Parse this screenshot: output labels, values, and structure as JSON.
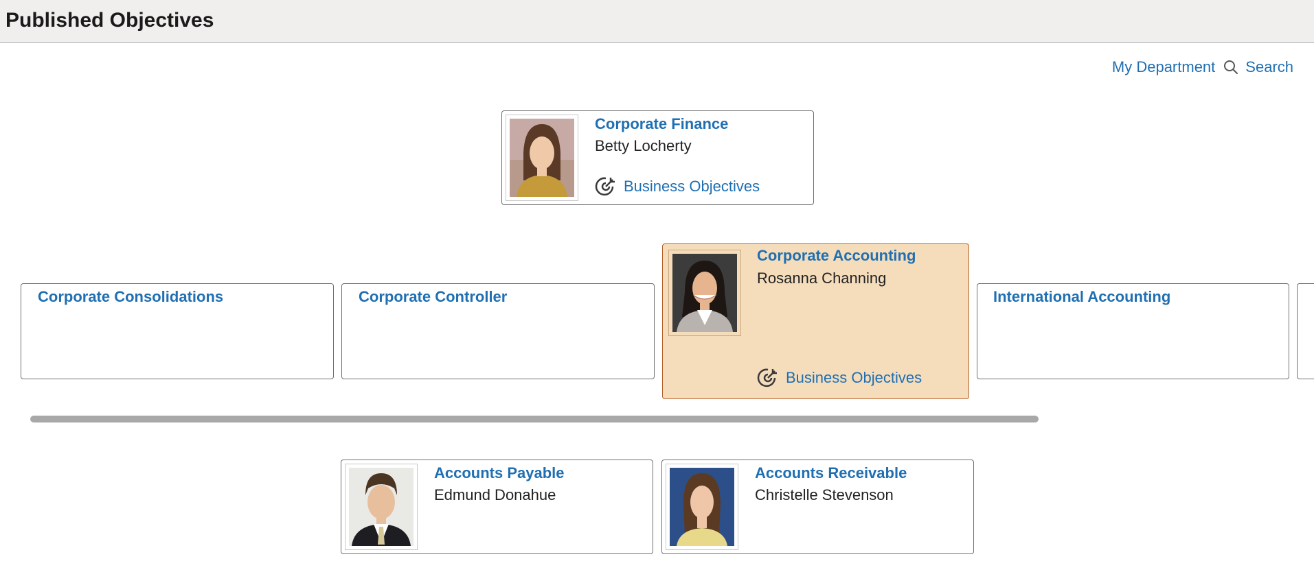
{
  "header": {
    "title": "Published Objectives"
  },
  "toolbar": {
    "my_department": "My Department",
    "search": "Search"
  },
  "org": {
    "root": {
      "title": "Corporate Finance",
      "person": "Betty Locherty",
      "link": "Business Objectives"
    },
    "level2": [
      {
        "title": "Corporate Consolidations"
      },
      {
        "title": "Corporate Controller"
      },
      {
        "title": "Corporate Accounting",
        "person": "Rosanna Channing",
        "link": "Business Objectives",
        "selected": true
      },
      {
        "title": "International Accounting"
      }
    ],
    "level3": [
      {
        "title": "Accounts Payable",
        "person": "Edmund Donahue"
      },
      {
        "title": "Accounts Receivable",
        "person": "Christelle Stevenson"
      }
    ]
  },
  "colors": {
    "link": "#1f6fb2",
    "selected_bg": "#f5ddbc",
    "selected_border": "#b4602a",
    "header_bg": "#f0efed"
  }
}
